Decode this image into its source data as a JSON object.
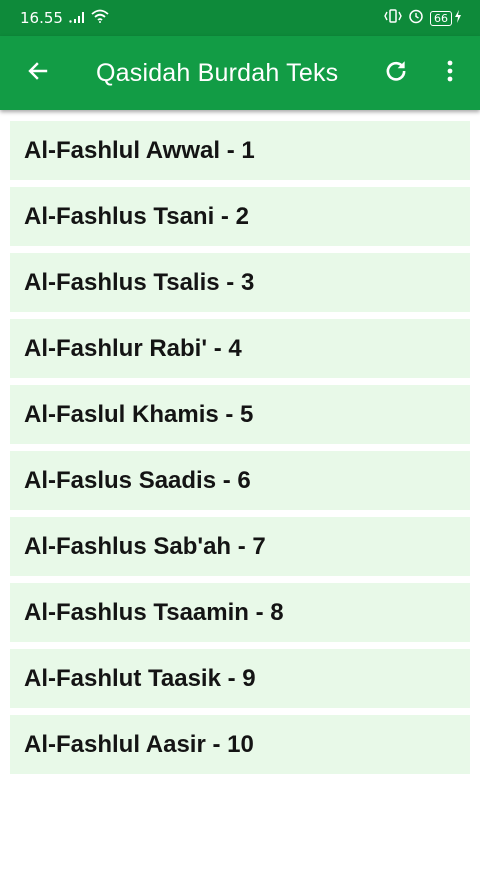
{
  "status_bar": {
    "time": "16.55",
    "battery_level": "66",
    "icons": [
      "signal-icon",
      "wifi-icon",
      "vibrate-icon",
      "alarm-icon",
      "battery-icon",
      "charging-icon"
    ]
  },
  "app_bar": {
    "title": "Qasidah Burdah Teks",
    "icons": [
      "back-arrow-icon",
      "refresh-icon",
      "more-vert-icon"
    ],
    "color": "#129c45"
  },
  "chapters": [
    {
      "label": "Al-Fashlul Awwal - 1"
    },
    {
      "label": "Al-Fashlus Tsani - 2"
    },
    {
      "label": "Al-Fashlus Tsalis - 3"
    },
    {
      "label": "Al-Fashlur Rabi' - 4"
    },
    {
      "label": "Al-Faslul Khamis - 5"
    },
    {
      "label": "Al-Faslus Saadis - 6"
    },
    {
      "label": "Al-Fashlus Sab'ah - 7"
    },
    {
      "label": "Al-Fashlus Tsaamin - 8"
    },
    {
      "label": "Al-Fashlut Taasik - 9"
    },
    {
      "label": "Al-Fashlul Aasir - 10"
    }
  ],
  "colors": {
    "status_bar": "#0e8a3a",
    "app_bar": "#129c45",
    "list_item_bg": "#e8f9e8",
    "list_item_text": "#141414"
  }
}
